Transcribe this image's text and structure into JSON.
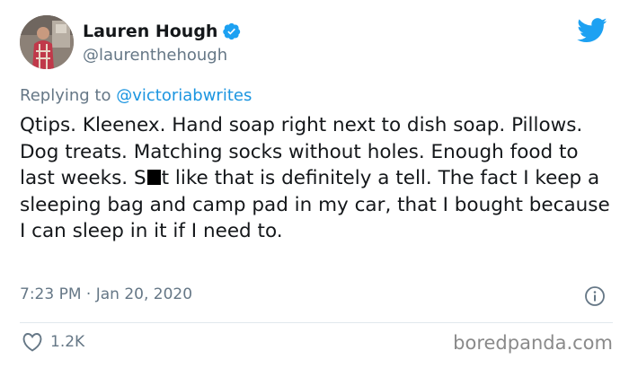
{
  "user": {
    "display_name": "Lauren Hough",
    "handle": "@laurenthehough",
    "verified": true
  },
  "reply": {
    "prefix": "Replying to",
    "mention": "@victoriabwrites"
  },
  "tweet": {
    "text_before_censor": "Qtips. Kleenex. Hand soap right next to dish soap. Pillows. Dog treats. Matching socks without holes. Enough food to last weeks. S",
    "text_after_censor": "t like that is definitely a tell. The fact I keep a sleeping bag and camp pad in my car, that I bought because I can sleep in it if I need to.",
    "timestamp": "7:23 PM · Jan 20, 2020"
  },
  "stats": {
    "likes": "1.2K"
  },
  "watermark": "boredpanda.com",
  "icons": {
    "brand": "twitter-bird-icon",
    "verified": "verified-badge-icon",
    "info": "info-icon",
    "like": "heart-icon"
  },
  "colors": {
    "twitter_blue": "#1da1f2",
    "link_blue": "#1b95e0",
    "secondary_text": "#657786",
    "primary_text": "#14171a",
    "divider": "#e1e8ed",
    "watermark": "#8a8a8a"
  }
}
